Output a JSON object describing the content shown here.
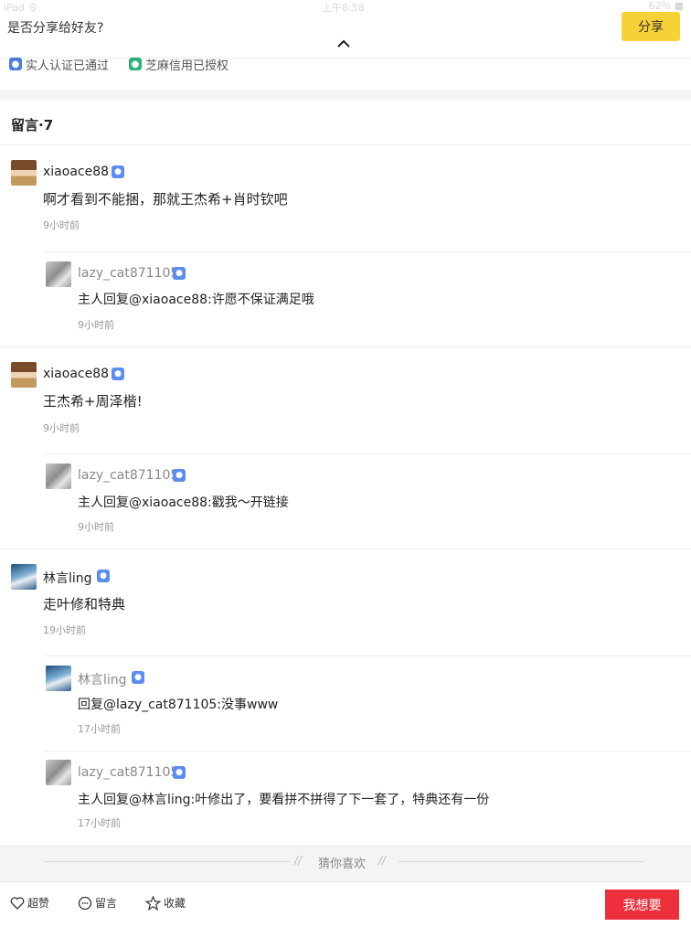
{
  "banner": {
    "question": "是否分享给好友?",
    "share_label": "分享"
  },
  "status_ghost": {
    "left": "iPad 令",
    "center": "上午8:58",
    "right": "62% ■"
  },
  "verify": {
    "realname": "实人认证已通过",
    "sesame": "芝麻信用已授权"
  },
  "comments_title": "留言·7",
  "comments": [
    {
      "user": "xiaoace88",
      "text": "啊才看到不能捆，那就王杰希+肖时钦吧",
      "time": "9小时前",
      "replies": [
        {
          "user": "lazy_cat871105",
          "text": "主人回复@xiaoace88:许愿不保证满足哦",
          "time": "9小时前"
        }
      ]
    },
    {
      "user": "xiaoace88",
      "text": "王杰希+周泽楷!",
      "time": "9小时前",
      "replies": [
        {
          "user": "lazy_cat871105",
          "text": "主人回复@xiaoace88:戳我～开链接",
          "time": "9小时前"
        }
      ]
    },
    {
      "user": "林言ling",
      "text": "走叶修和特典",
      "time": "19小时前",
      "replies": [
        {
          "user": "林言ling",
          "text": "回复@lazy_cat871105:没事www",
          "time": "17小时前"
        },
        {
          "user": "lazy_cat871105",
          "text": "主人回复@林言ling:叶修出了，要看拼不拼得了下一套了，特典还有一份",
          "time": "17小时前"
        }
      ]
    }
  ],
  "guess_label": "猜你喜欢",
  "bottom_bar": {
    "like": "超赞",
    "comment": "留言",
    "favorite": "收藏",
    "want": "我想要"
  },
  "colors": {
    "share_button": "#f7d236",
    "want_button": "#ec2f3b",
    "verify_blue": "#5b8df0"
  }
}
